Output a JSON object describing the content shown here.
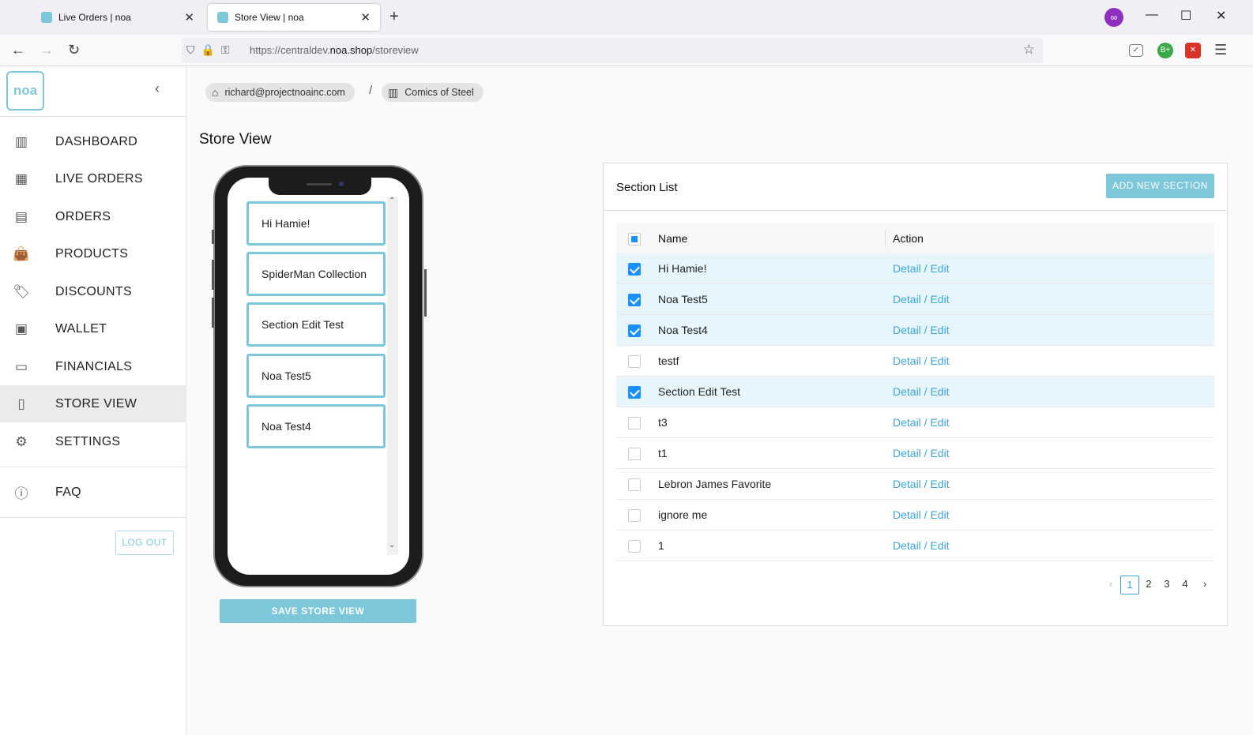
{
  "browser": {
    "tabs": [
      {
        "label": "Live Orders | noa"
      },
      {
        "label": "Store View | noa"
      }
    ],
    "url_prefix": "https://centraldev.",
    "url_domain": "noa.shop",
    "url_path": "/storeview"
  },
  "sidebar": {
    "logo": "noa",
    "items": [
      {
        "label": "DASHBOARD",
        "icon": "bar-chart-icon"
      },
      {
        "label": "LIVE ORDERS",
        "icon": "grid-icon"
      },
      {
        "label": "ORDERS",
        "icon": "list-icon"
      },
      {
        "label": "PRODUCTS",
        "icon": "shopping-bag-icon"
      },
      {
        "label": "DISCOUNTS",
        "icon": "tag-icon"
      },
      {
        "label": "WALLET",
        "icon": "wallet-icon"
      },
      {
        "label": "FINANCIALS",
        "icon": "credit-card-icon"
      },
      {
        "label": "STORE VIEW",
        "icon": "mobile-icon"
      },
      {
        "label": "SETTINGS",
        "icon": "gear-icon"
      },
      {
        "label": "FAQ",
        "icon": "question-icon"
      }
    ],
    "active": "STORE VIEW",
    "logout_label": "LOG OUT"
  },
  "breadcrumb": {
    "user": "richard@projectnoainc.com",
    "store": "Comics of Steel"
  },
  "page_title": "Store View",
  "phone": {
    "cards": [
      "Hi Hamie!",
      "SpiderMan Collection",
      "Section Edit Test",
      "Noa Test5",
      "Noa Test4"
    ]
  },
  "save_label": "SAVE STORE VIEW",
  "section_list": {
    "title": "Section List",
    "add_label": "ADD NEW SECTION",
    "col_name": "Name",
    "col_action": "Action",
    "action_label": "Detail / Edit",
    "rows": [
      {
        "name": "Hi Hamie!",
        "checked": true
      },
      {
        "name": "Noa Test5",
        "checked": true
      },
      {
        "name": "Noa Test4",
        "checked": true
      },
      {
        "name": "testf",
        "checked": false
      },
      {
        "name": "Section Edit Test",
        "checked": true
      },
      {
        "name": "t3",
        "checked": false
      },
      {
        "name": "t1",
        "checked": false
      },
      {
        "name": "Lebron James Favorite",
        "checked": false
      },
      {
        "name": "ignore me",
        "checked": false
      },
      {
        "name": "1",
        "checked": false
      }
    ],
    "pages": [
      "1",
      "2",
      "3",
      "4"
    ],
    "current_page": "1"
  },
  "colors": {
    "accent": "#7cc7da",
    "link": "#3ca6d6",
    "checkbox": "#1890ff",
    "selected_row": "#e6f6fc"
  }
}
